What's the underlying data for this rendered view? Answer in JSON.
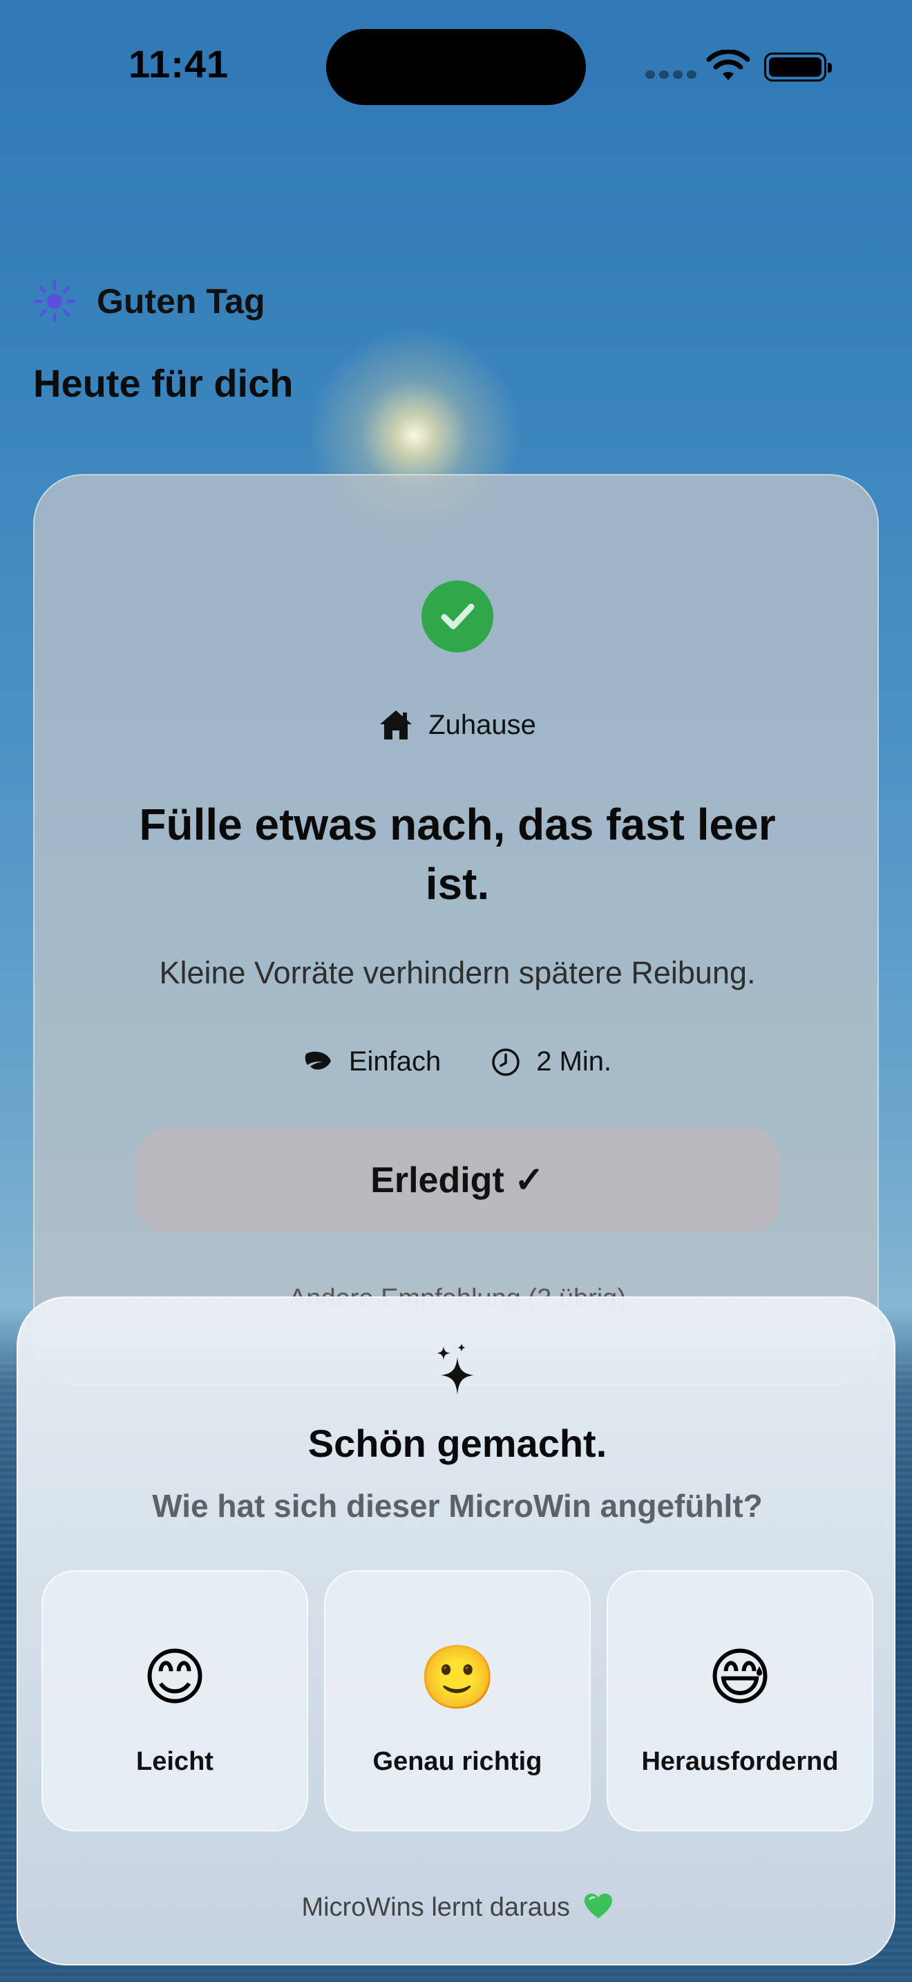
{
  "status_bar": {
    "time": "11:41"
  },
  "header": {
    "greeting": "Guten Tag",
    "title": "Heute für dich"
  },
  "card": {
    "category": "Zuhause",
    "title": "Fülle etwas nach, das fast leer ist.",
    "subtitle": "Kleine Vorräte verhindern spätere Reibung.",
    "difficulty": "Einfach",
    "duration": "2 Min.",
    "done_label": "Erledigt ✓",
    "other_link": "Andere Empfehlung (2 übrig)"
  },
  "feedback": {
    "title": "Schön gemacht.",
    "question": "Wie hat sich dieser MicroWin angefühlt?",
    "options": [
      {
        "emoji": "😊",
        "label": "Leicht"
      },
      {
        "emoji": "🙂",
        "label": "Genau richtig"
      },
      {
        "emoji": "😅",
        "label": "Herausfordernd"
      }
    ],
    "footnote": "MicroWins lernt daraus"
  },
  "colors": {
    "accent_green": "#2ea84a",
    "sun_icon": "#5b4fe0",
    "heart": "#3cc05a"
  },
  "icons": [
    "sun-icon",
    "checkmark-icon",
    "house-icon",
    "leaf-icon",
    "clock-icon",
    "sparkle-icon",
    "heart-icon",
    "wifi-icon",
    "battery-icon"
  ]
}
